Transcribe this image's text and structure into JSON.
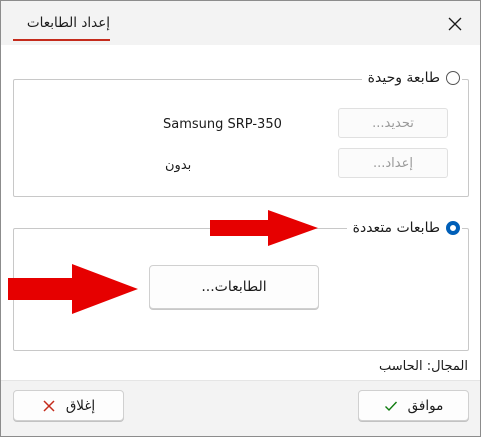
{
  "dialog": {
    "title": "إعداد الطابعات",
    "close_icon": "close-icon",
    "accent_color": "#c42b1c"
  },
  "single_printer": {
    "label": "طابعة وحيدة",
    "selected": false,
    "printer_name": "Samsung SRP-350",
    "select_button": "تحديد...",
    "paper_setting": "بدون",
    "setup_button": "إعداد..."
  },
  "multi_printer": {
    "label": "طابعات متعددة",
    "selected": true,
    "printers_button": "الطابعات..."
  },
  "scope_text": "المجال: الحاسب",
  "footer": {
    "close_button": "إغلاق",
    "ok_button": "موافق"
  },
  "annotations": {
    "arrow_color": "#e60000"
  }
}
